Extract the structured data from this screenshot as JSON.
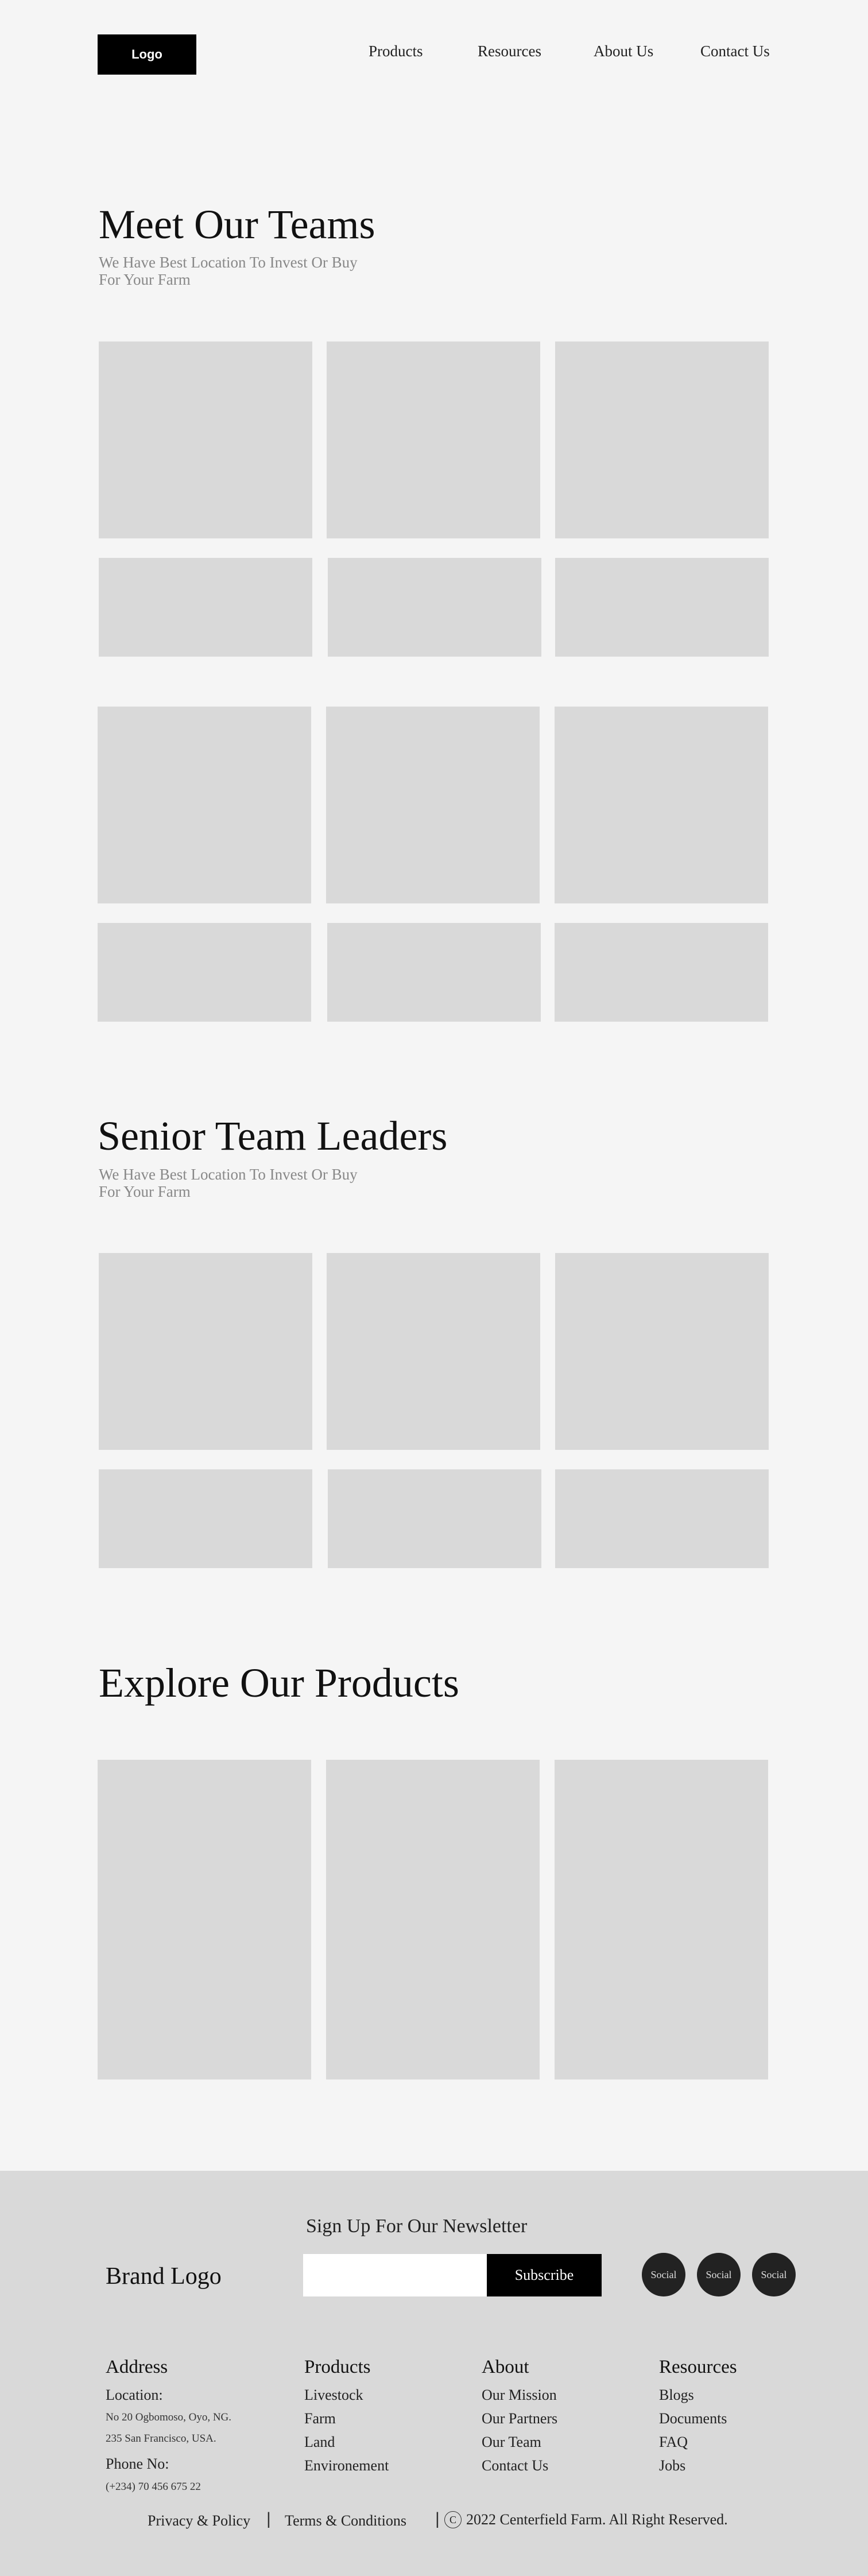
{
  "header": {
    "logo": "Logo",
    "nav": [
      "Products",
      "Resources",
      "About Us",
      "Contact Us"
    ]
  },
  "teams": {
    "title": "Meet Our Teams",
    "subtitle": "We Have Best Location To Invest Or Buy For Your Farm"
  },
  "leaders": {
    "title": "Senior Team Leaders",
    "subtitle": "We Have Best Location To Invest Or Buy For Your Farm"
  },
  "products": {
    "title": "Explore Our Products"
  },
  "footer": {
    "newsletter_title": "Sign Up For Our Newsletter",
    "brand_logo": "Brand Logo",
    "email_placeholder": "",
    "subscribe_label": "Subscribe",
    "socials": [
      "Social",
      "Social",
      "Social"
    ],
    "address": {
      "title": "Address",
      "location_label": "Location:",
      "location_line1": "No 20 Ogbomoso, Oyo, NG.",
      "location_line2": "235 San Francisco, USA.",
      "phone_label": "Phone No:",
      "phone": "(+234) 70 456 675 22"
    },
    "products_col": {
      "title": "Products",
      "links": [
        "Livestock",
        "Farm",
        "Land",
        "Environement"
      ]
    },
    "about_col": {
      "title": "About",
      "links": [
        "Our Mission",
        "Our Partners",
        "Our Team",
        "Contact Us"
      ]
    },
    "resources_col": {
      "title": "Resources",
      "links": [
        "Blogs",
        "Documents",
        "FAQ",
        "Jobs"
      ]
    },
    "bottom": {
      "privacy": "Privacy & Policy",
      "terms": "Terms & Conditions",
      "separator": "|",
      "copyright_symbol": "C",
      "copyright": "2022 Centerfield Farm. All Right Reserved."
    }
  }
}
